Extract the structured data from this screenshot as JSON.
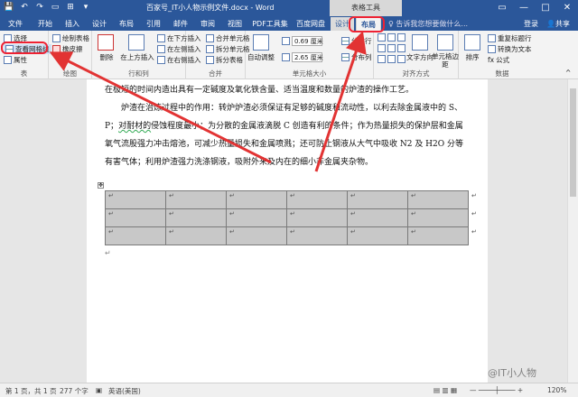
{
  "titlebar": {
    "title": "百家号_IT小人物示例文件.docx - Word",
    "context_group": "表格工具",
    "qat": [
      "💾",
      "↶",
      "↷",
      "▭",
      "⊞",
      "▾"
    ],
    "window_controls": [
      "▭",
      "—",
      "□",
      "✕"
    ]
  },
  "tabs": {
    "file": "文件",
    "items": [
      "开始",
      "插入",
      "设计",
      "布局",
      "引用",
      "邮件",
      "审阅",
      "视图",
      "PDF工具集",
      "百度网盘"
    ],
    "context": [
      "设计",
      "布局"
    ],
    "search": "告诉我您想要做什么...",
    "login": "登录",
    "share": "共享"
  },
  "ribbon": {
    "table_group": {
      "select": "选择",
      "gridlines": "查看网格线",
      "properties": "属性",
      "label": "表"
    },
    "draw_group": {
      "draw_table": "绘制表格",
      "eraser": "橡皮擦",
      "label": "绘图"
    },
    "delete": "删除",
    "rows_cols": {
      "insert_above": "在上方插入",
      "insert_below": "在下方插入",
      "insert_left": "在左侧插入",
      "insert_right": "在右侧插入",
      "label": "行和列"
    },
    "merge": {
      "merge_cells": "合并单元格",
      "split_cells": "拆分单元格",
      "split_table": "拆分表格",
      "label": "合并"
    },
    "cell_size": {
      "autofit": "自动调整",
      "height": "0.69 厘米",
      "width": "2.65 厘米",
      "distribute_rows": "分布行",
      "distribute_cols": "分布列",
      "label": "单元格大小"
    },
    "alignment": {
      "text_direction": "文字方向",
      "cell_margins": "单元格边距",
      "label": "对齐方式"
    },
    "data": {
      "sort": "排序",
      "repeat_header": "重复标题行",
      "convert_text": "转换为文本",
      "formula": "公式",
      "label": "数据"
    }
  },
  "document": {
    "para1": "在极短的时间内造出具有一定碱度及氧化铁含量、适当温度和数量的炉渣的操作工艺。",
    "para2_a": "炉渣在治炼过程中的作用：转炉炉渣必须保证有足够的碱度和流动性，以利去除金属液中的 S、P；",
    "para2_u": "对耐材的",
    "para2_b": "侵蚀程度最小；为分散的金属液滴脱 C 创造有利的条件；作为热量损失的保护层和金属氧气流股强力冲击熔池，可减少热量损失和金属喷溅；还可防止钢液从大气中吸收 N2 及 H2O 分等有害气体；利用炉渣强力洗涤钢液，吸附外来及内在的细小非金属夹杂物。",
    "cell_mark": "↵",
    "para_mark": "↵",
    "move_handle": "✥"
  },
  "statusbar": {
    "page": "第 1 页，共 1 页",
    "words": "277 个字",
    "lang": "英语(美国)",
    "zoom": "120%"
  },
  "watermark": "@IT小人物",
  "colors": {
    "word_blue": "#2b579a",
    "annotation_red": "#e23333"
  }
}
